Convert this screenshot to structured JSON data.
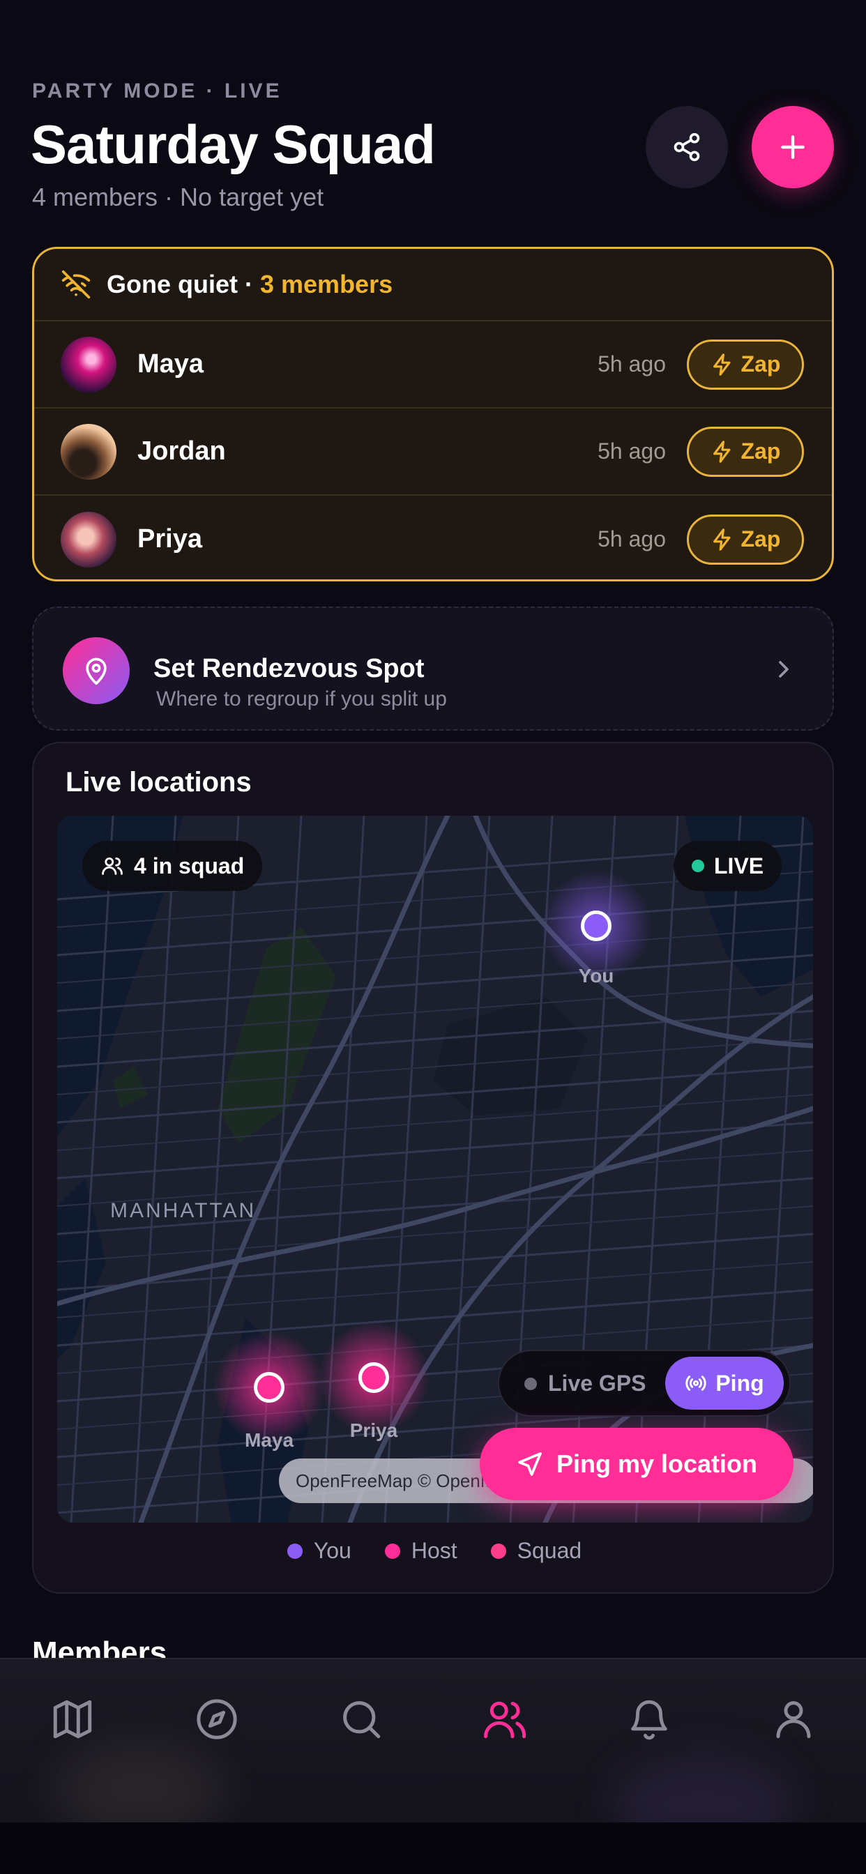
{
  "header": {
    "eyebrow": "PARTY MODE · LIVE",
    "title": "Saturday Squad",
    "subtitle": "4 members · No target yet"
  },
  "quiet": {
    "label": "Gone quiet ·",
    "count": "3 members",
    "members": [
      {
        "name": "Maya",
        "time": "5h ago",
        "action": "Zap"
      },
      {
        "name": "Jordan",
        "time": "5h ago",
        "action": "Zap"
      },
      {
        "name": "Priya",
        "time": "5h ago",
        "action": "Zap"
      }
    ]
  },
  "rendezvous": {
    "title": "Set Rendezvous Spot",
    "subtitle": "Where to regroup if you split up"
  },
  "live": {
    "title": "Live locations",
    "squad_chip": "4 in squad",
    "live_chip": "LIVE",
    "place_label": "MANHATTAN",
    "pins": [
      {
        "label": "You",
        "color": "#8b5cf6"
      },
      {
        "label": "Maya",
        "color": "#ff2d95"
      },
      {
        "label": "Priya",
        "color": "#ff2d95"
      }
    ],
    "gps_label": "Live GPS",
    "ping_label": "Ping",
    "ping_location": "Ping my location",
    "attribution": "OpenFreeMap © OpenMapTiles Data from OpenStreetMap"
  },
  "legend": [
    {
      "label": "You",
      "color": "#8b5cf6"
    },
    {
      "label": "Host",
      "color": "#ff2d95"
    },
    {
      "label": "Squad",
      "color": "#ff3d8a"
    }
  ],
  "members_heading": "Members",
  "nav": [
    {
      "icon": "map-icon"
    },
    {
      "icon": "compass-icon"
    },
    {
      "icon": "search-icon"
    },
    {
      "icon": "users-icon",
      "active": true
    },
    {
      "icon": "bell-icon"
    },
    {
      "icon": "profile-icon"
    }
  ],
  "colors": {
    "accent": "#ff2d95",
    "you": "#8b5cf6",
    "warning": "#e8b43a"
  }
}
